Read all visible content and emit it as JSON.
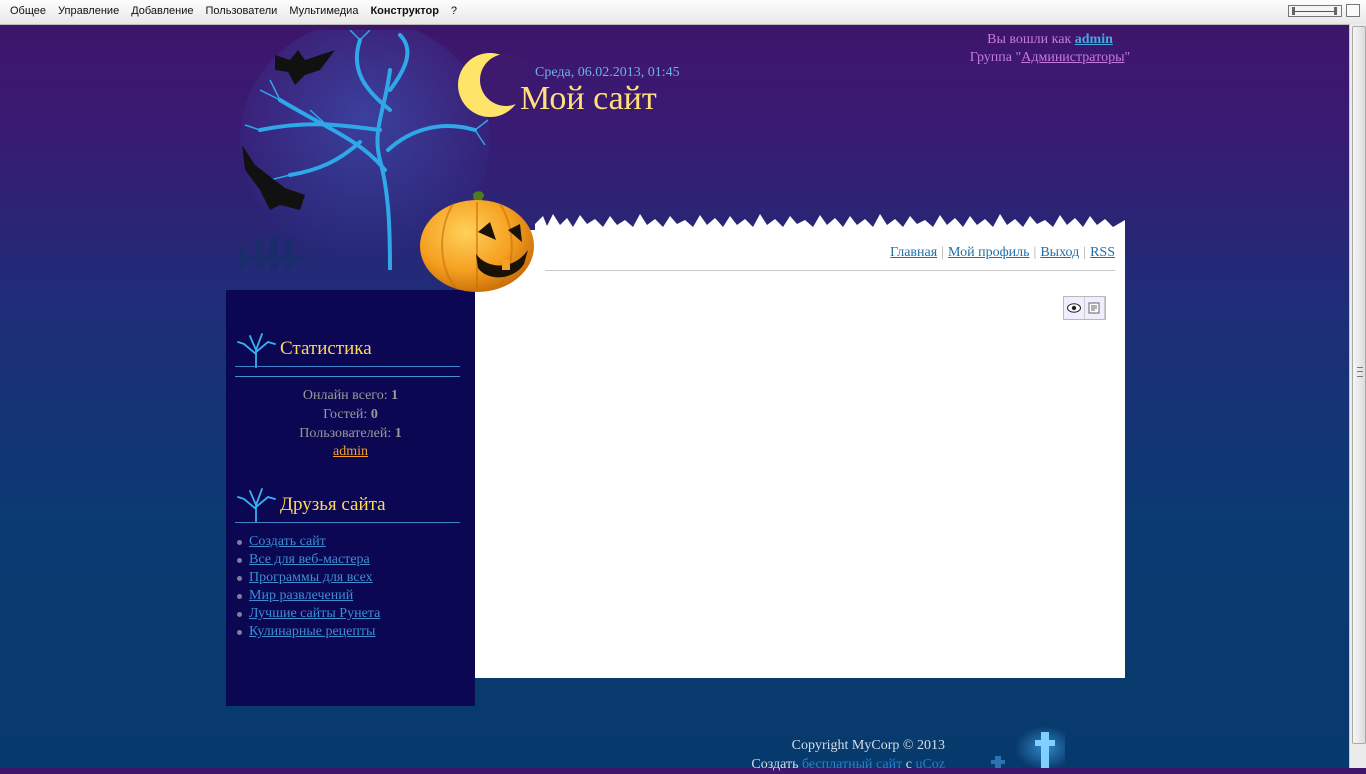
{
  "topbar": {
    "menu": [
      "Общее",
      "Управление",
      "Добавление",
      "Пользователи",
      "Мультимедиа",
      "Конструктор",
      "?"
    ]
  },
  "header": {
    "date": "Среда, 06.02.2013, 01:45",
    "title": "Мой сайт",
    "login_prefix": "Вы вошли как",
    "login_user": "admin",
    "group_prefix": "Группа \"",
    "group_name": "Администраторы",
    "group_suffix": "\""
  },
  "nav": {
    "items": [
      "Главная",
      "Мой профиль",
      "Выход",
      "RSS"
    ],
    "separator": "|"
  },
  "stats": {
    "title": "Статистика",
    "online_label": "Онлайн всего:",
    "online_value": "1",
    "guests_label": "Гостей:",
    "guests_value": "0",
    "users_label": "Пользователей:",
    "users_value": "1",
    "user_link": "admin"
  },
  "friends": {
    "title": "Друзья сайта",
    "links": [
      "Создать сайт",
      "Все для веб-мастера",
      "Программы для всех",
      "Мир развлечений",
      "Лучшие сайты Рунета",
      "Кулинарные рецепты"
    ]
  },
  "footer": {
    "copyright": "Copyright MyCorp © 2013",
    "create_text": "Создать",
    "create_link": "бесплатный сайт",
    "with_text": "с",
    "ucoz_link": "uCoz"
  },
  "colors": {
    "title": "#ffe07a",
    "sidebar_bg": "#0b0753",
    "link": "#1f6fa8",
    "stat_user_link": "#f6a22a"
  }
}
